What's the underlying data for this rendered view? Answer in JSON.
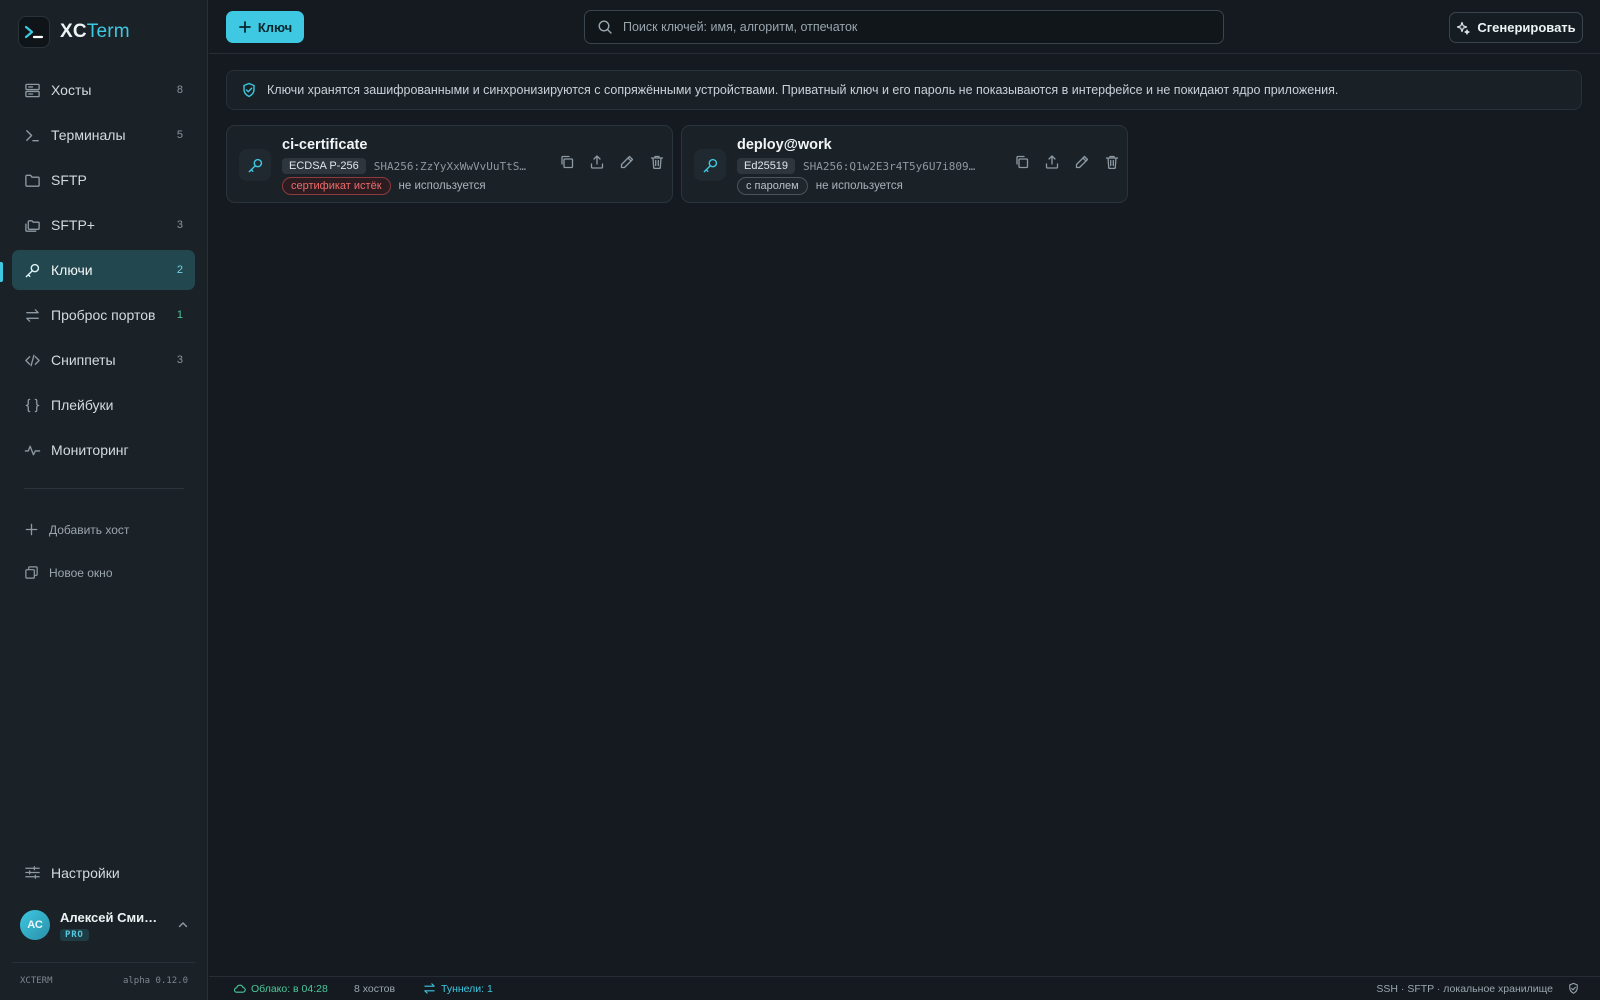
{
  "app": {
    "name_part1": "XC",
    "name_part2": "Term",
    "brand_color": "#3ec8e2"
  },
  "sidebar": {
    "items": [
      {
        "label": "Хосты",
        "count": "8",
        "icon": "server-icon"
      },
      {
        "label": "Терминалы",
        "count": "5",
        "icon": "terminal-icon"
      },
      {
        "label": "SFTP",
        "count": "",
        "icon": "folder-icon"
      },
      {
        "label": "SFTP+",
        "count": "3",
        "icon": "folders-icon"
      },
      {
        "label": "Ключи",
        "count": "2",
        "icon": "key-icon",
        "active": true
      },
      {
        "label": "Проброс портов",
        "count": "1",
        "icon": "arrows-icon"
      },
      {
        "label": "Сниппеты",
        "count": "3",
        "icon": "code-icon"
      },
      {
        "label": "Плейбуки",
        "count": "",
        "icon": "braces-icon"
      },
      {
        "label": "Мониторинг",
        "count": "",
        "icon": "activity-icon"
      }
    ],
    "add_host": "Добавить хост",
    "new_window": "Новое окно",
    "settings": "Настройки",
    "user": {
      "initials": "АС",
      "name": "Алексей Смирн...",
      "plan": "PRO"
    },
    "footer_left": "XCTERM",
    "footer_right": "alpha 0.12.0"
  },
  "toolbar": {
    "add_key_label": "Ключ",
    "search_placeholder": "Поиск ключей: имя, алгоритм, отпечаток",
    "generate_label": "Сгенерировать"
  },
  "banner": {
    "text": "Ключи хранятся зашифрованными и синхронизируются с сопряжёнными устройствами. Приватный ключ и его пароль не показываются в интерфейсе и не покидают ядро приложения."
  },
  "keys": [
    {
      "name": "ci-certificate",
      "algorithm": "ECDSA P-256",
      "fingerprint": "SHA256:ZzYyXxWwVvUuTtS…",
      "tag": "сертификат истёк",
      "tag_kind": "danger",
      "usage": "не используется"
    },
    {
      "name": "deploy@work",
      "algorithm": "Ed25519",
      "fingerprint": "SHA256:Q1w2E3r4T5y6U7i809…",
      "tag": "с паролем",
      "tag_kind": "neutral",
      "usage": "не используется"
    }
  ],
  "statusbar": {
    "cloud": "Облако: в 04:28",
    "hosts": "8 хостов",
    "tunnels": "Туннели: 1",
    "right": "SSH · SFTP · локальное хранилище"
  }
}
